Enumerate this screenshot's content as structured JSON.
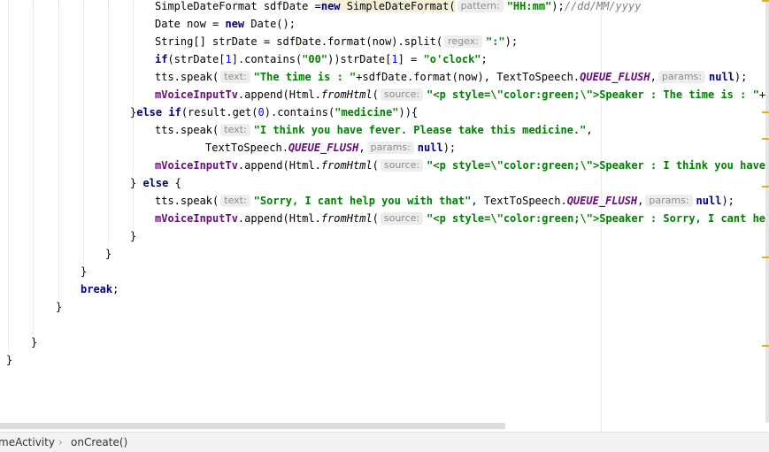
{
  "code": {
    "l1": {
      "a": "SimpleDateFormat sdfDate =",
      "kw": "new",
      "b": " SimpleDateFormat(",
      "hint": "pattern:",
      "str": "\"HH:mm\"",
      "c": ");",
      "cmt": "//dd/MM/yyyy"
    },
    "l2": {
      "a": "Date now = ",
      "kw": "new",
      "b": " Date();"
    },
    "l3": {
      "a": "String[] strDate = sdfDate.format(now).split(",
      "hint": "regex:",
      "str": "\":\"",
      "b": ");"
    },
    "l4": {
      "kw": "if",
      "a": "(strDate[",
      "n1": "1",
      "b": "].contains(",
      "s1": "\"00\"",
      "c": "))strDate[",
      "n2": "1",
      "d": "] = ",
      "s2": "\"o'clock\"",
      "e": ";"
    },
    "l5": {
      "a": "tts.speak(",
      "hint1": "text:",
      "str": "\"The time is : \"",
      "b": "+sdfDate.format(now), TextToSpeech.",
      "sf": "QUEUE_FLUSH",
      "c": ",",
      "hint2": "params:",
      "kw": "null",
      "d": ");"
    },
    "l6": {
      "fld": "mVoiceInputTv",
      "a": ".append(Html.",
      "it": "fromHtml",
      "b": "(",
      "hint": "source:",
      "str": "\"<p style=\\\"color:green;\\\">Speaker : The time is : \"",
      "c": "+sdfD"
    },
    "l7": {
      "a": "}",
      "kw1": "else if",
      "b": "(result.get(",
      "n": "0",
      "c": ").contains(",
      "str": "\"medicine\"",
      "d": ")){"
    },
    "l8": {
      "a": "tts.speak(",
      "hint": "text:",
      "str": "\"I think you have fever. Please take this medicine.\"",
      "b": ","
    },
    "l9": {
      "a": "TextToSpeech.",
      "sf": "QUEUE_FLUSH",
      "b": ",",
      "hint": "params:",
      "kw": "null",
      "c": ");"
    },
    "l10": {
      "fld": "mVoiceInputTv",
      "a": ".append(Html.",
      "it": "fromHtml",
      "b": "(",
      "hint": "source:",
      "str": "\"<p style=\\\"color:green;\\\">Speaker : I think you have fev"
    },
    "l11": {
      "a": "} ",
      "kw": "else",
      "b": " {"
    },
    "l12": {
      "a": "tts.speak(",
      "hint1": "text:",
      "str": "\"Sorry, I cant help you with that\"",
      "b": ", TextToSpeech.",
      "sf": "QUEUE_FLUSH",
      "c": ",",
      "hint2": "params:",
      "kw": "null",
      "d": ");"
    },
    "l13": {
      "fld": "mVoiceInputTv",
      "a": ".append(Html.",
      "it": "fromHtml",
      "b": "(",
      "hint": "source:",
      "str": "\"<p style=\\\"color:green;\\\">Speaker : Sorry, I cant help y"
    },
    "l14": {
      "a": "}"
    },
    "l15": {
      "a": "}"
    },
    "l16": {
      "a": "}"
    },
    "l17": {
      "kw": "break",
      "a": ";"
    },
    "l18": {
      "a": "}"
    },
    "l19": {
      "a": "}"
    },
    "l20": {
      "a": "}"
    }
  },
  "breadcrumb": {
    "item1": "meActivity",
    "sep": "›",
    "item2": "onCreate()"
  },
  "colors": {
    "keyword": "#000080",
    "string": "#008000",
    "field": "#660e7a",
    "comment": "#808080",
    "marker": "#e8b000"
  }
}
